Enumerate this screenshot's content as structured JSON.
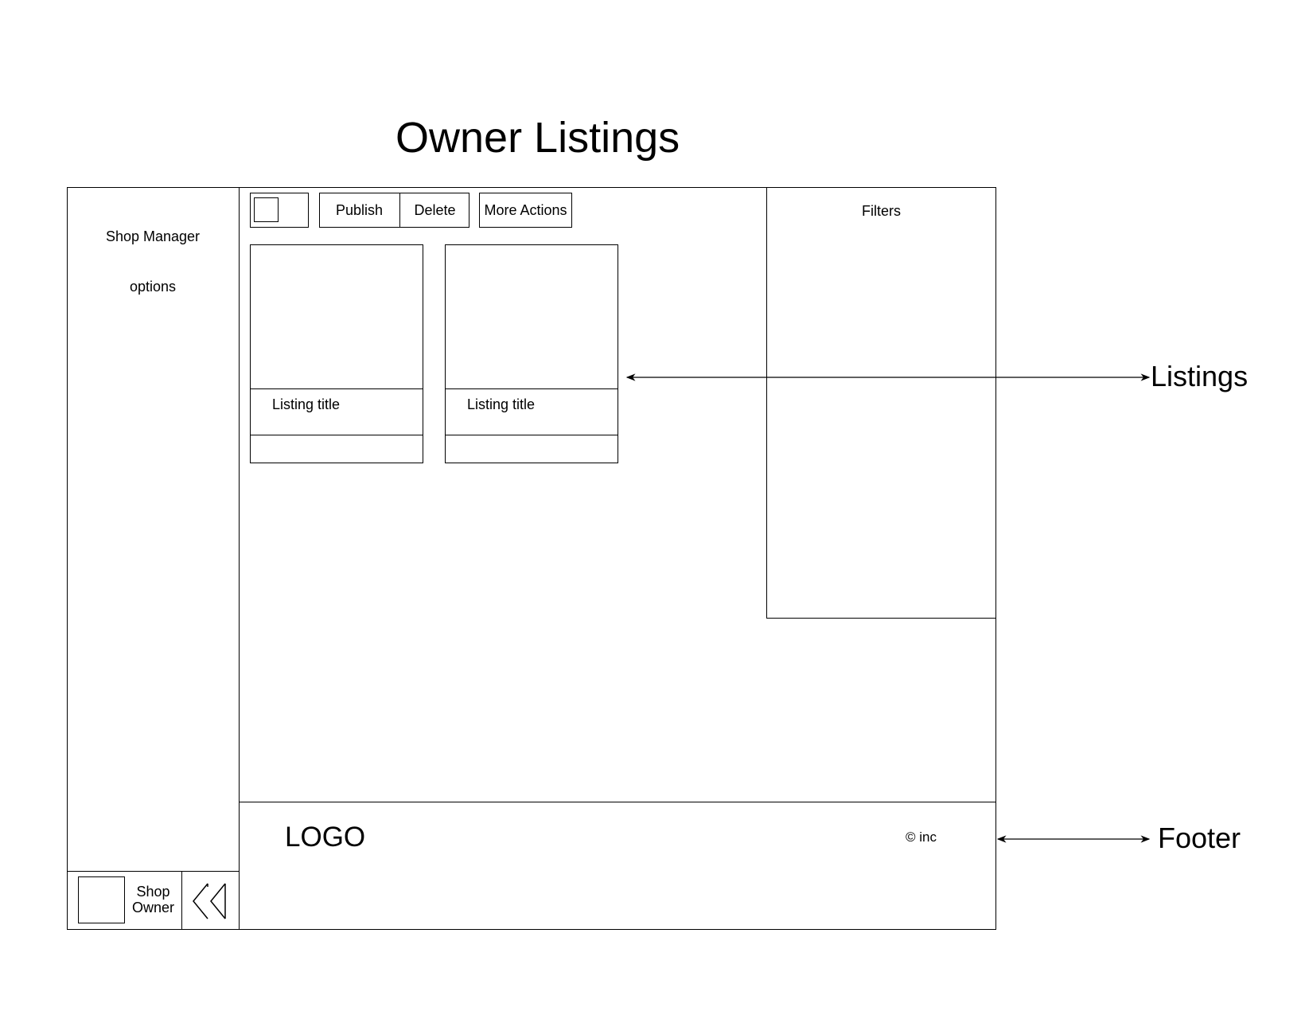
{
  "page": {
    "title": "Owner Listings"
  },
  "sidebar": {
    "title": "Shop Manager",
    "options_label": "options",
    "owner_label": "Shop\nOwner",
    "collapse_icon": "double-chevron-left-icon"
  },
  "toolbar": {
    "publish_label": "Publish",
    "delete_label": "Delete",
    "more_actions_label": "More Actions"
  },
  "filters": {
    "label": "Filters"
  },
  "listings": [
    {
      "title": "Listing title"
    },
    {
      "title": "Listing title"
    }
  ],
  "footer": {
    "logo": "LOGO",
    "copyright": "© inc"
  },
  "annotations": {
    "listings": "Listings",
    "footer": "Footer"
  }
}
